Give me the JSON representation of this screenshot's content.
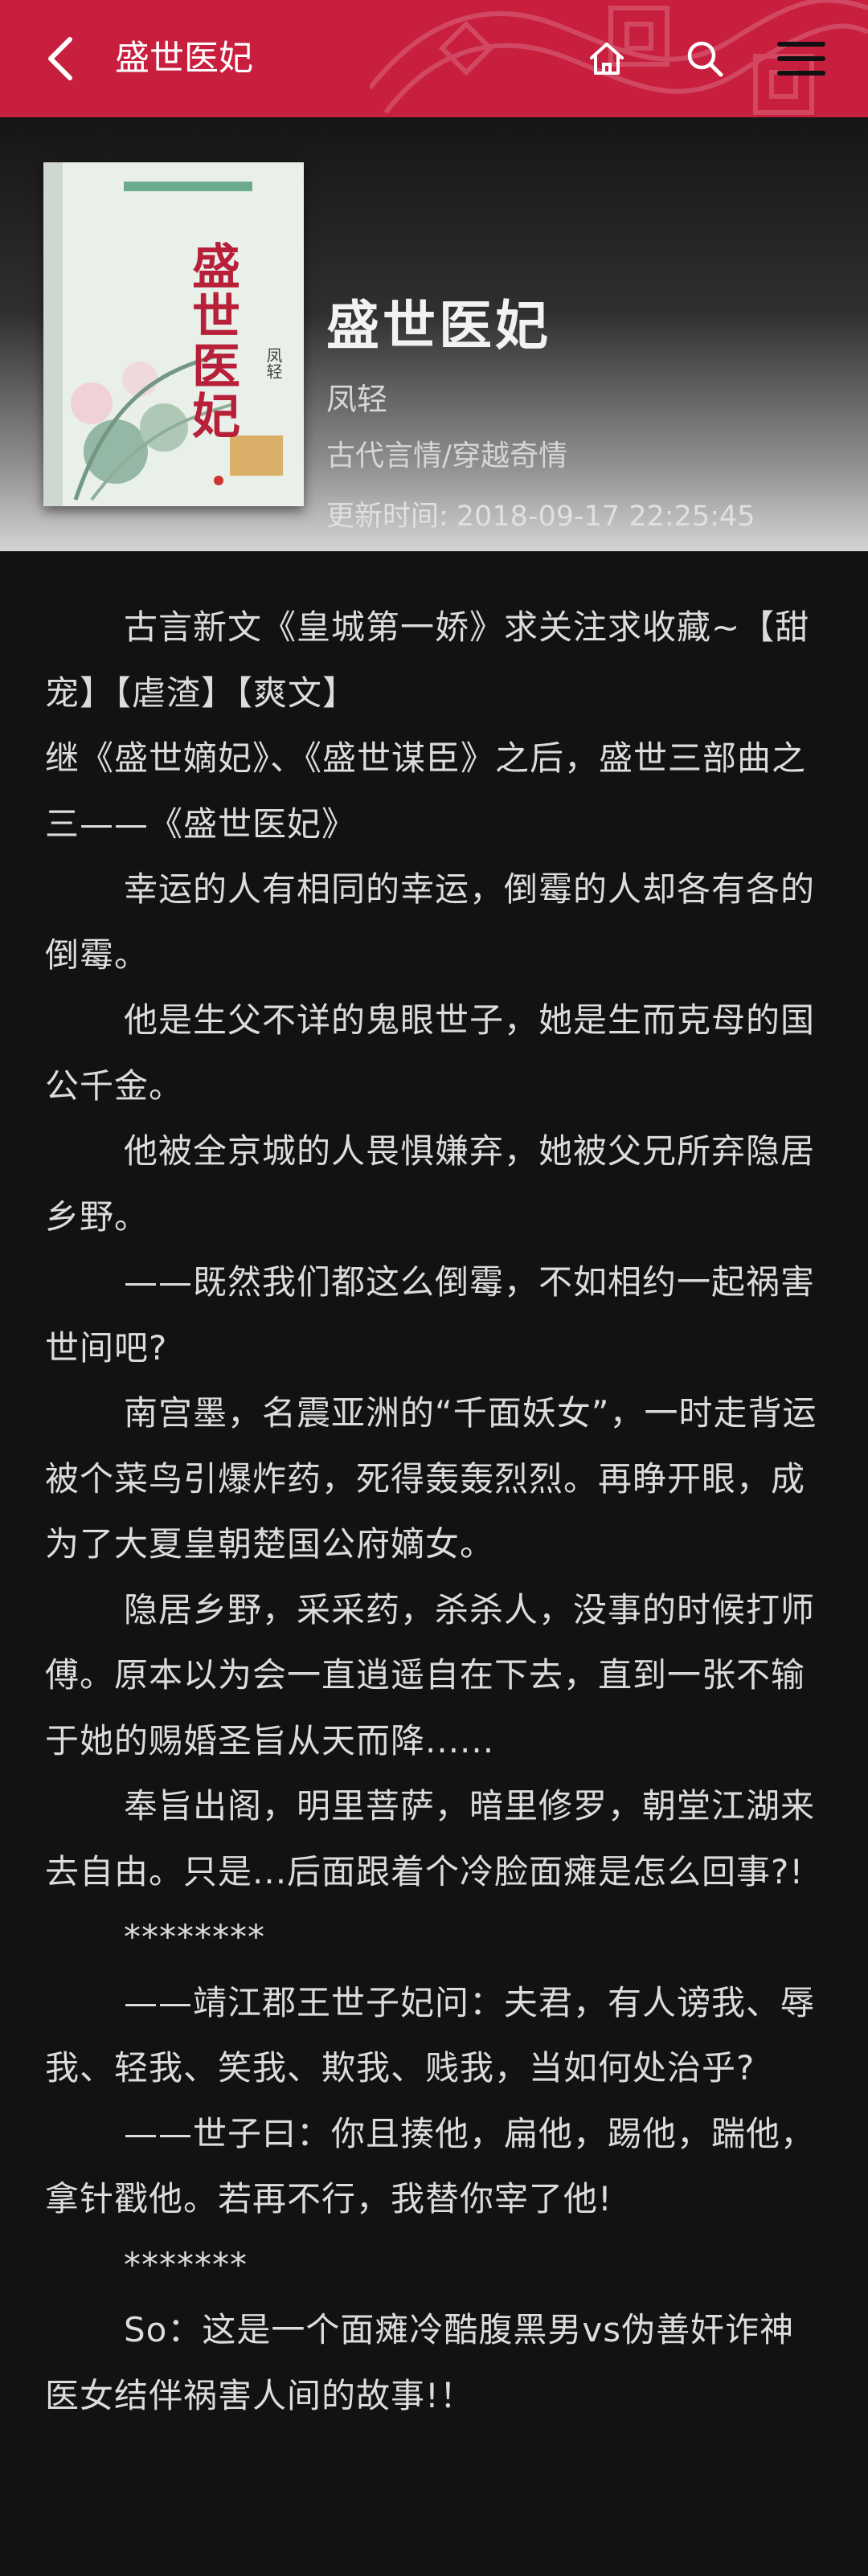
{
  "header": {
    "title": "盛世医妃",
    "back_icon": "back-arrow-icon",
    "home_icon": "home-icon",
    "search_icon": "search-icon",
    "menu_icon": "hamburger-menu-icon",
    "bg_color": "#c81f3f"
  },
  "book": {
    "title": "盛世医妃",
    "author": "凤轻",
    "category": "古代言情/穿越奇情",
    "updated_label": "更新时间:",
    "updated_value": "2018-09-17 22:25:45",
    "cover_title": "盛世医妃"
  },
  "description": [
    {
      "indent": true,
      "text": "古言新文《皇城第一娇》求关注求收藏~【甜宠】【虐渣】【爽文】"
    },
    {
      "indent": false,
      "text": "继《盛世嫡妃》、《盛世谋臣》之后，盛世三部曲之三——《盛世医妃》"
    },
    {
      "indent": true,
      "text": "幸运的人有相同的幸运，倒霉的人却各有各的倒霉。"
    },
    {
      "indent": true,
      "text": "他是生父不详的鬼眼世子，她是生而克母的国公千金。"
    },
    {
      "indent": true,
      "text": "他被全京城的人畏惧嫌弃，她被父兄所弃隐居乡野。"
    },
    {
      "indent": true,
      "text": "——既然我们都这么倒霉，不如相约一起祸害世间吧?"
    },
    {
      "indent": true,
      "text": "南宫墨，名震亚洲的“千面妖女”，一时走背运被个菜鸟引爆炸药，死得轰轰烈烈。再睁开眼，成为了大夏皇朝楚国公府嫡女。"
    },
    {
      "indent": true,
      "text": "隐居乡野，采采药，杀杀人，没事的时候打师傅。原本以为会一直逍遥自在下去，直到一张不输于她的赐婚圣旨从天而降......"
    },
    {
      "indent": true,
      "text": "奉旨出阁，明里菩萨，暗里修罗，朝堂江湖来去自由。只是...后面跟着个冷脸面瘫是怎么回事?!"
    },
    {
      "indent": true,
      "text": "********"
    },
    {
      "indent": true,
      "text": "——靖江郡王世子妃问：夫君，有人谤我、辱我、轻我、笑我、欺我、贱我，当如何处治乎?"
    },
    {
      "indent": true,
      "text": "——世子曰：你且揍他，扁他，踢他，踹他，拿针戳他。若再不行，我替你宰了他!"
    },
    {
      "indent": true,
      "text": "*******"
    },
    {
      "indent": true,
      "text": "So：这是一个面瘫冷酷腹黑男vs伪善奸诈神医女结伴祸害人间的故事!！"
    }
  ]
}
